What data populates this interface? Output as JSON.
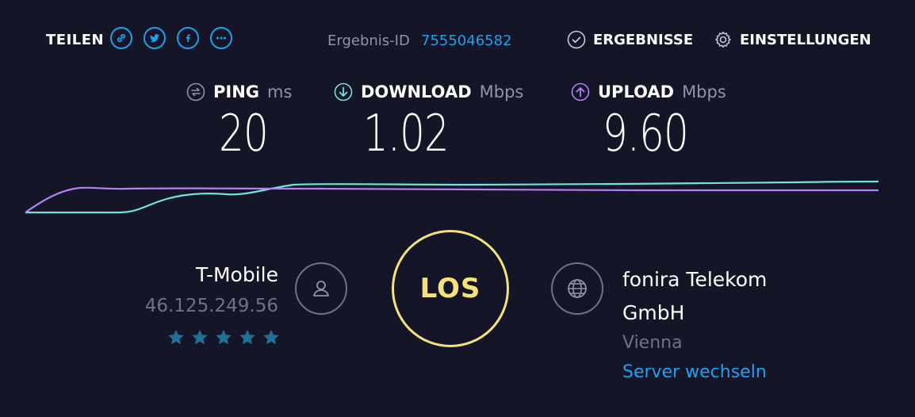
{
  "share": {
    "label": "TEILEN",
    "icons": [
      "link-icon",
      "twitter-icon",
      "facebook-icon",
      "more-icon"
    ]
  },
  "result": {
    "id_label": "Ergebnis-ID",
    "id_value": "7555046582"
  },
  "nav": {
    "results_label": "ERGEBNISSE",
    "settings_label": "EINSTELLUNGEN"
  },
  "metrics": {
    "ping": {
      "label": "PING",
      "unit": "ms",
      "value": "20"
    },
    "download": {
      "label": "DOWNLOAD",
      "unit": "Mbps",
      "value": "1.02"
    },
    "upload": {
      "label": "UPLOAD",
      "unit": "Mbps",
      "value": "9.60"
    }
  },
  "isp": {
    "name": "T-Mobile",
    "ip": "46.125.249.56",
    "rating": 5
  },
  "go_button": {
    "label": "LOS"
  },
  "server": {
    "name": "fonira Telekom GmbH",
    "location": "Vienna",
    "change_label": "Server wechseln"
  },
  "colors": {
    "background": "#141526",
    "accent_blue": "#1da1f2",
    "download": "#6fe3e1",
    "upload": "#b57ff5",
    "go_yellow": "#f6e27b",
    "muted": "#9193a8",
    "star": "#1f6f96"
  }
}
